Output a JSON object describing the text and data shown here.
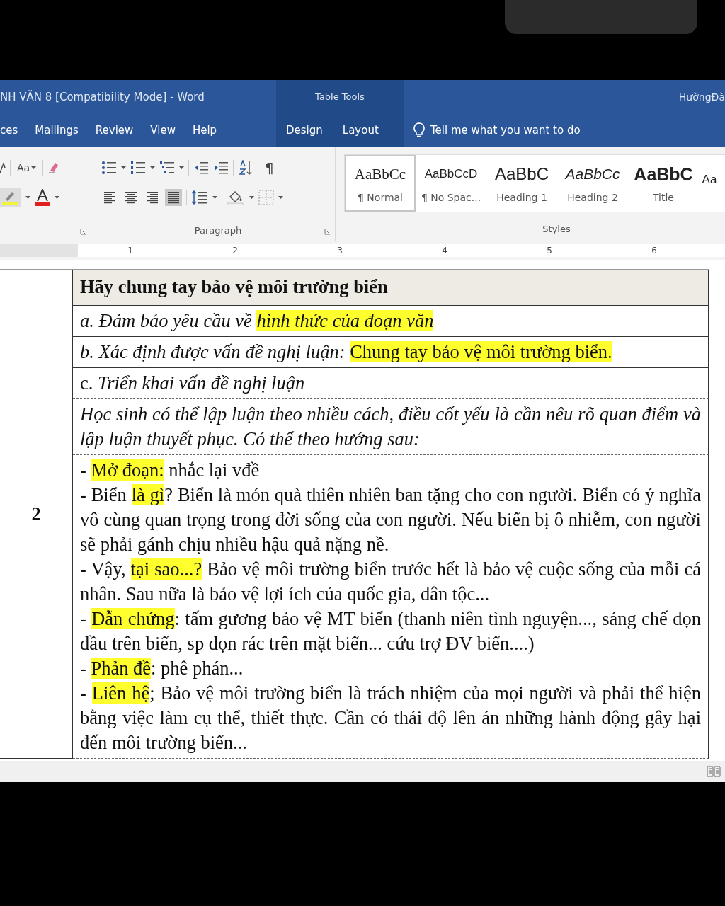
{
  "title_bar": {
    "title": "NH VĂN 8 [Compatibility Mode]  -  Word",
    "context_label": "Table Tools",
    "user": "HườngĐà"
  },
  "tabs": [
    {
      "label": "ces",
      "selected": false
    },
    {
      "label": "Mailings",
      "selected": false
    },
    {
      "label": "Review",
      "selected": false
    },
    {
      "label": "View",
      "selected": false
    },
    {
      "label": "Help",
      "selected": false
    }
  ],
  "table_tools_tabs": [
    {
      "label": "Design",
      "selected": false
    },
    {
      "label": "Layout",
      "selected": false
    }
  ],
  "tell_me": {
    "placeholder": "Tell me what you want to do"
  },
  "ribbon": {
    "font_group": {
      "change_case": "Aa"
    },
    "paragraph_group": {
      "label": "Paragraph",
      "show_marks": "¶",
      "alignments": [
        {
          "kind": "left",
          "selected": false
        },
        {
          "kind": "center",
          "selected": false
        },
        {
          "kind": "right",
          "selected": false
        },
        {
          "kind": "justify",
          "selected": true
        }
      ]
    },
    "styles_group": {
      "label": "Styles",
      "styles": [
        {
          "preview": "AaBbCc",
          "name": "¶ Normal",
          "kind": "normal",
          "selected": true
        },
        {
          "preview": "AaBbCcD",
          "name": "¶ No Spac...",
          "kind": "no_spacing",
          "selected": false
        },
        {
          "preview": "AaBbC",
          "name": "Heading 1",
          "kind": "heading1",
          "selected": false
        },
        {
          "preview": "AaBbCc",
          "name": "Heading 2",
          "kind": "heading2",
          "selected": false
        },
        {
          "preview": "AaBbC",
          "name": "Title",
          "kind": "title",
          "selected": false
        },
        {
          "preview": "Aa",
          "kind": "subtitle",
          "selected": false
        }
      ]
    }
  },
  "ruler": {
    "numbers": [
      "1",
      "2",
      "3",
      "4",
      "5",
      "6"
    ]
  },
  "table": {
    "row_number": "2",
    "rows": [
      {
        "kind": "header",
        "dashed_top": false,
        "paragraphs": [
          {
            "runs": [
              {
                "text": "Hãy chung tay bảo vệ môi trường biển",
                "highlight": false
              }
            ]
          }
        ]
      },
      {
        "kind": "body",
        "dashed_top": false,
        "paragraphs": [
          {
            "runs": [
              {
                "text": "*a. Đảm bảo yêu cầu về* ",
                "highlight": false
              },
              {
                "text": "*hình thức của đoạn văn*",
                "highlight": true
              }
            ]
          }
        ]
      },
      {
        "kind": "body",
        "dashed_top": false,
        "paragraphs": [
          {
            "runs": [
              {
                "text": "*b. Xác định được vấn đề nghị luận:* ",
                "highlight": false
              },
              {
                "text": "Chung tay bảo vệ môi trường biển.",
                "highlight": true
              }
            ]
          }
        ]
      },
      {
        "kind": "body",
        "dashed_top": false,
        "paragraphs": [
          {
            "runs": [
              {
                "text": "c. *Triển khai vấn đề nghị luận*",
                "highlight": false
              }
            ]
          }
        ]
      },
      {
        "kind": "body",
        "dashed_top": true,
        "paragraphs": [
          {
            "runs": [
              {
                "text": "*Học sinh có thể lập luận theo nhiều cách, điều cốt yếu là cần nêu rõ quan điểm và lập luận thuyết phục. Có thể theo hướng sau:*",
                "highlight": false
              }
            ]
          }
        ]
      },
      {
        "kind": "body",
        "dashed_top": true,
        "paragraphs": [
          {
            "runs": [
              {
                "text": "- ",
                "highlight": false
              },
              {
                "text": "Mở đoạn:",
                "highlight": true
              },
              {
                "text": " nhắc lại vđề",
                "highlight": false
              }
            ]
          },
          {
            "runs": [
              {
                "text": "- Biển ",
                "highlight": false
              },
              {
                "text": "là gì",
                "highlight": true
              },
              {
                "text": "? Biển là món quà thiên nhiên ban tặng cho con người. Biển có ý nghĩa vô cùng quan trọng trong đời sống của con người. Nếu biển bị ô nhiễm, con người sẽ phải gánh chịu nhiều hậu quả nặng nề.",
                "highlight": false
              }
            ]
          },
          {
            "runs": [
              {
                "text": "- Vậy, ",
                "highlight": false
              },
              {
                "text": "tại sao...?",
                "highlight": true
              },
              {
                "text": " Bảo vệ môi trường biển trước hết là bảo vệ cuộc sống của mỗi cá nhân. Sau nữa là bảo vệ lợi ích của quốc gia, dân tộc...",
                "highlight": false
              }
            ]
          },
          {
            "runs": [
              {
                "text": "- ",
                "highlight": false
              },
              {
                "text": "Dẫn chứng",
                "highlight": true
              },
              {
                "text": ": tấm gương bảo vệ MT biển (thanh niên tình nguyện..., sáng chế dọn dầu trên biển, sp dọn rác trên mặt biển... cứu trợ ĐV biển....)",
                "highlight": false
              }
            ]
          },
          {
            "runs": [
              {
                "text": "- ",
                "highlight": false
              },
              {
                "text": "Phản đề",
                "highlight": true
              },
              {
                "text": ": phê phán...",
                "highlight": false
              }
            ]
          },
          {
            "runs": [
              {
                "text": "- ",
                "highlight": false
              },
              {
                "text": "Liên hệ",
                "highlight": true
              },
              {
                "text": "; Bảo vệ môi trường biển là trách nhiệm của mọi người và phải thể hiện bằng việc làm cụ thể, thiết thực. Cần có thái độ lên án những hành động gây hại đến môi trường biển...",
                "highlight": false
              }
            ]
          }
        ]
      }
    ]
  }
}
